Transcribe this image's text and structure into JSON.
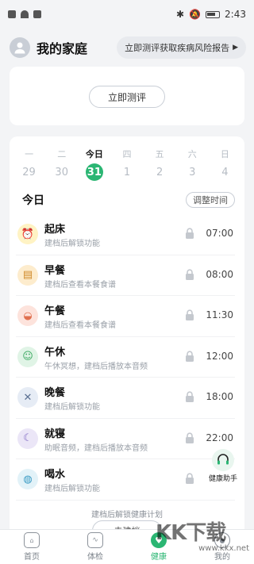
{
  "status_bar": {
    "time": "2:43"
  },
  "header": {
    "title": "我的家庭",
    "risk_report_label": "立即测评获取疾病风险报告"
  },
  "top_card": {
    "evaluate_label": "立即测评"
  },
  "calendar": {
    "days": [
      {
        "name": "一",
        "num": "29",
        "today": false
      },
      {
        "name": "二",
        "num": "30",
        "today": false
      },
      {
        "name": "今日",
        "num": "31",
        "today": true
      },
      {
        "name": "四",
        "num": "1",
        "today": false
      },
      {
        "name": "五",
        "num": "2",
        "today": false
      },
      {
        "name": "六",
        "num": "3",
        "today": false
      },
      {
        "name": "日",
        "num": "4",
        "today": false
      }
    ]
  },
  "today": {
    "label": "今日",
    "adjust_label": "调整时间"
  },
  "schedule": [
    {
      "title": "起床",
      "desc": "建档后解锁功能",
      "time": "07:00",
      "icon": "alarm-clock-icon",
      "color": "#fff3c4",
      "glyph": "⏰"
    },
    {
      "title": "早餐",
      "desc": "建档后查看本餐食谱",
      "time": "08:00",
      "icon": "bread-icon",
      "color": "#fdeccd",
      "glyph": "🍞"
    },
    {
      "title": "午餐",
      "desc": "建档后查看本餐食谱",
      "time": "11:30",
      "icon": "bowl-icon",
      "color": "#fde3dc",
      "glyph": "🍜"
    },
    {
      "title": "午休",
      "desc": "午休冥想，建档后播放本音频",
      "time": "12:00",
      "icon": "smile-icon",
      "color": "#e0f4e6",
      "glyph": "☺"
    },
    {
      "title": "晚餐",
      "desc": "建档后解锁功能",
      "time": "18:00",
      "icon": "cutlery-icon",
      "color": "#e6ecf5",
      "glyph": "🍴"
    },
    {
      "title": "就寝",
      "desc": "助眠音频，建档后播放本音频",
      "time": "22:00",
      "icon": "moon-icon",
      "color": "#ebe6f7",
      "glyph": "☾"
    },
    {
      "title": "喝水",
      "desc": "建档后解锁功能",
      "time": "",
      "icon": "water-drop-icon",
      "color": "#e2f2f8",
      "glyph": "💧"
    }
  ],
  "footer_note": "建档后解锁健康计划",
  "create_label": "去建档",
  "assistant_label": "健康助手",
  "nav": [
    {
      "label": "首页",
      "icon": "home-icon",
      "active": false
    },
    {
      "label": "体检",
      "icon": "checkup-icon",
      "active": false
    },
    {
      "label": "健康",
      "icon": "health-heart-icon",
      "active": true
    },
    {
      "label": "我的",
      "icon": "profile-icon",
      "active": false
    }
  ],
  "watermark": {
    "text": "KK下载",
    "sub": "www.kkx.net"
  },
  "colors": {
    "accent": "#2bb673",
    "background": "#f3f4f6"
  }
}
